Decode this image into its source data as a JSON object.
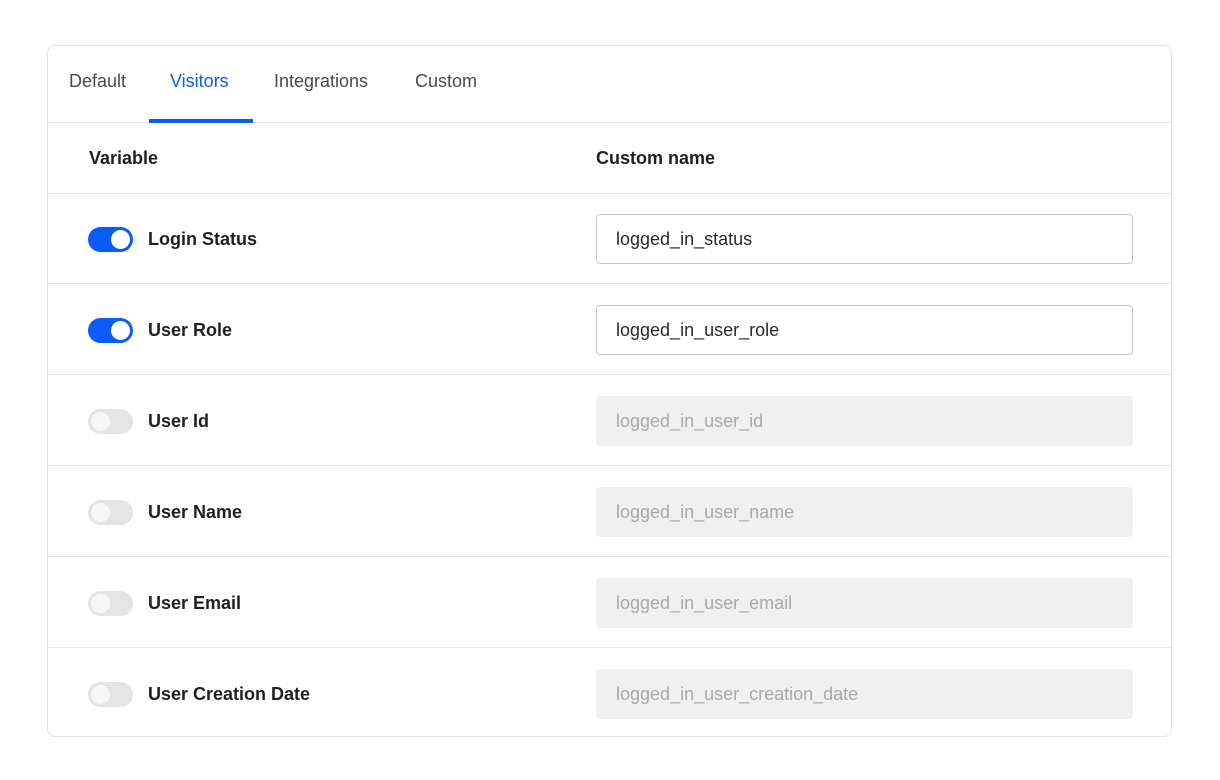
{
  "colors": {
    "accent": "#0a5cf5"
  },
  "tabs": [
    {
      "label": "Default",
      "active": false
    },
    {
      "label": "Visitors",
      "active": true
    },
    {
      "label": "Integrations",
      "active": false
    },
    {
      "label": "Custom",
      "active": false
    }
  ],
  "table": {
    "headers": {
      "variable": "Variable",
      "custom_name": "Custom name"
    },
    "rows": [
      {
        "label": "Login Status",
        "enabled": true,
        "value": "logged_in_status",
        "placeholder": ""
      },
      {
        "label": "User Role",
        "enabled": true,
        "value": "logged_in_user_role",
        "placeholder": ""
      },
      {
        "label": "User Id",
        "enabled": false,
        "value": "",
        "placeholder": "logged_in_user_id"
      },
      {
        "label": "User Name",
        "enabled": false,
        "value": "",
        "placeholder": "logged_in_user_name"
      },
      {
        "label": "User Email",
        "enabled": false,
        "value": "",
        "placeholder": "logged_in_user_email"
      },
      {
        "label": "User Creation Date",
        "enabled": false,
        "value": "",
        "placeholder": "logged_in_user_creation_date"
      }
    ]
  }
}
